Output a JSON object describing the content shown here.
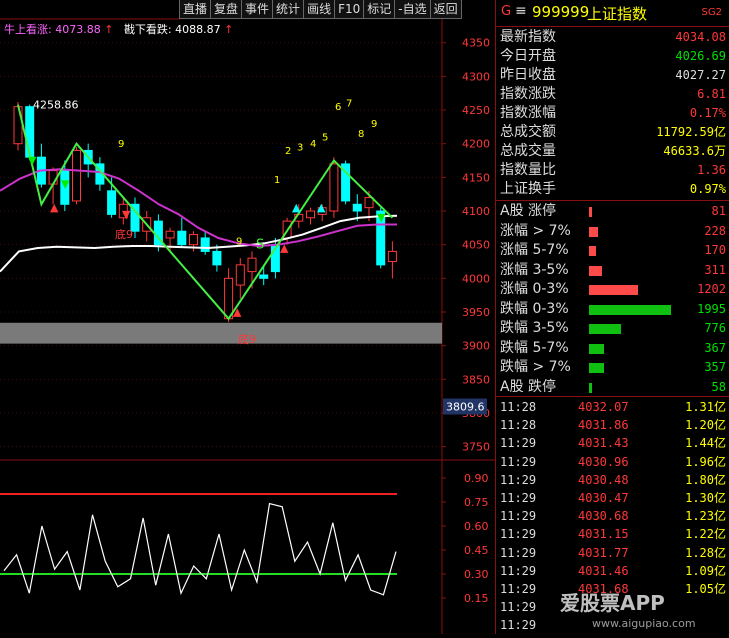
{
  "toolbar": [
    "直播",
    "复盘",
    "事件",
    "统计",
    "画线",
    "F10",
    "标记",
    "-自选",
    "返回"
  ],
  "legend": {
    "bull_label": "牛上看涨:",
    "bull_value": "4073.88",
    "bull_arrow": "↑",
    "bear_label": "戡下看跌:",
    "bear_value": "4088.87",
    "bear_arrow": "↑"
  },
  "chart_data": {
    "type": "candlestick",
    "ylim_main": [
      3700,
      4380
    ],
    "y_ticks_main": [
      "4350",
      "4300",
      "4250",
      "4200",
      "4150",
      "4100",
      "4050",
      "4000",
      "3950",
      "3900",
      "3850",
      "3800",
      "3750"
    ],
    "ylim_osc": [
      0,
      1.0
    ],
    "y_ticks_osc": [
      "0.90",
      "0.75",
      "0.60",
      "0.45",
      "0.30",
      "0.15"
    ],
    "price_tag": "3809.6",
    "annotations": {
      "high_label": "4258.86",
      "low_label": "底9",
      "mid_label": "底9",
      "seq_top": [
        "1",
        "2",
        "3",
        "4",
        "5",
        "6",
        "7",
        "8",
        "9"
      ],
      "seq_nine": "9",
      "s_marker": "S"
    },
    "candles": [
      {
        "o": 4200,
        "h": 4262,
        "l": 4190,
        "c": 4255
      },
      {
        "o": 4255,
        "h": 4258,
        "l": 4175,
        "c": 4180
      },
      {
        "o": 4180,
        "h": 4200,
        "l": 4135,
        "c": 4140
      },
      {
        "o": 4140,
        "h": 4165,
        "l": 4110,
        "c": 4160
      },
      {
        "o": 4160,
        "h": 4175,
        "l": 4100,
        "c": 4110
      },
      {
        "o": 4115,
        "h": 4195,
        "l": 4110,
        "c": 4190
      },
      {
        "o": 4190,
        "h": 4200,
        "l": 4150,
        "c": 4170
      },
      {
        "o": 4170,
        "h": 4180,
        "l": 4130,
        "c": 4140
      },
      {
        "o": 4130,
        "h": 4150,
        "l": 4090,
        "c": 4095
      },
      {
        "o": 4090,
        "h": 4120,
        "l": 4080,
        "c": 4110
      },
      {
        "o": 4110,
        "h": 4120,
        "l": 4060,
        "c": 4070
      },
      {
        "o": 4070,
        "h": 4100,
        "l": 4055,
        "c": 4090
      },
      {
        "o": 4085,
        "h": 4095,
        "l": 4040,
        "c": 4050
      },
      {
        "o": 4060,
        "h": 4075,
        "l": 4040,
        "c": 4070
      },
      {
        "o": 4070,
        "h": 4090,
        "l": 4045,
        "c": 4050
      },
      {
        "o": 4050,
        "h": 4070,
        "l": 4040,
        "c": 4065
      },
      {
        "o": 4060,
        "h": 4070,
        "l": 4035,
        "c": 4040
      },
      {
        "o": 4040,
        "h": 4050,
        "l": 4010,
        "c": 4020
      },
      {
        "o": 3940,
        "h": 4015,
        "l": 3935,
        "c": 4000
      },
      {
        "o": 3990,
        "h": 4030,
        "l": 3970,
        "c": 4020
      },
      {
        "o": 4010,
        "h": 4040,
        "l": 3985,
        "c": 4030
      },
      {
        "o": 4005,
        "h": 4020,
        "l": 3990,
        "c": 4000
      },
      {
        "o": 4050,
        "h": 4060,
        "l": 4000,
        "c": 4010
      },
      {
        "o": 4060,
        "h": 4090,
        "l": 4050,
        "c": 4085
      },
      {
        "o": 4085,
        "h": 4110,
        "l": 4075,
        "c": 4095
      },
      {
        "o": 4090,
        "h": 4105,
        "l": 4080,
        "c": 4100
      },
      {
        "o": 4095,
        "h": 4110,
        "l": 4085,
        "c": 4105
      },
      {
        "o": 4100,
        "h": 4180,
        "l": 4090,
        "c": 4170
      },
      {
        "o": 4170,
        "h": 4175,
        "l": 4110,
        "c": 4115
      },
      {
        "o": 4110,
        "h": 4125,
        "l": 4085,
        "c": 4100
      },
      {
        "o": 4105,
        "h": 4130,
        "l": 4085,
        "c": 4120
      },
      {
        "o": 4100,
        "h": 4105,
        "l": 4015,
        "c": 4020
      },
      {
        "o": 4025,
        "h": 4055,
        "l": 4000,
        "c": 4040
      }
    ],
    "ma_white": [
      4010,
      4040,
      4045,
      4047,
      4046,
      4045,
      4047,
      4048,
      4048,
      4047,
      4046,
      4045,
      4047,
      4049,
      4052,
      4058,
      4065,
      4075,
      4085,
      4090,
      4092,
      4093
    ],
    "ma_magenta": [
      4130,
      4148,
      4160,
      4162,
      4160,
      4158,
      4148,
      4130,
      4110,
      4095,
      4075,
      4060,
      4052,
      4048,
      4050,
      4055,
      4062,
      4070,
      4078,
      4080,
      4080
    ],
    "zigzag": [
      4258,
      4110,
      4200,
      3940,
      4175,
      4090
    ],
    "osc_line": [
      0.32,
      0.42,
      0.18,
      0.6,
      0.33,
      0.44,
      0.2,
      0.67,
      0.38,
      0.22,
      0.27,
      0.65,
      0.23,
      0.55,
      0.18,
      0.35,
      0.27,
      0.55,
      0.2,
      0.45,
      0.25,
      0.74,
      0.72,
      0.38,
      0.5,
      0.3,
      0.62,
      0.26,
      0.42,
      0.2,
      0.17,
      0.44
    ],
    "osc_red_level": 0.8,
    "osc_green_level": 0.3
  },
  "sidebar": {
    "header": {
      "g": "G",
      "menu": "≡",
      "code": "999999",
      "name": "上证指数",
      "badge": "SG2"
    },
    "stats": [
      {
        "label": "最新指数",
        "value": "4034.08",
        "color": "#ff3838"
      },
      {
        "label": "今日开盘",
        "value": "4026.69",
        "color": "#00e000"
      },
      {
        "label": "昨日收盘",
        "value": "4027.27",
        "color": "#dddddd"
      },
      {
        "label": "指数涨跌",
        "value": "6.81",
        "color": "#ff3838"
      },
      {
        "label": "指数涨幅",
        "value": "0.17%",
        "color": "#ff3838"
      },
      {
        "label": "总成交额",
        "value": "11792.59亿",
        "color": "#ffff00"
      },
      {
        "label": "总成交量",
        "value": "46633.6万",
        "color": "#ffff00"
      },
      {
        "label": "指数量比",
        "value": "1.36",
        "color": "#ff3838"
      },
      {
        "label": "上证换手",
        "value": "0.97%",
        "color": "#ffff00"
      }
    ],
    "breadth": [
      {
        "label": "A股 涨停",
        "value": "81",
        "color": "#ff3838",
        "bar_color": "#ff4a4a",
        "count": 81
      },
      {
        "label": "涨幅 > 7%",
        "value": "228",
        "color": "#ff3838",
        "bar_color": "#ff4a4a",
        "count": 228
      },
      {
        "label": "涨幅 5-7%",
        "value": "170",
        "color": "#ff3838",
        "bar_color": "#ff4a4a",
        "count": 170
      },
      {
        "label": "涨幅 3-5%",
        "value": "311",
        "color": "#ff3838",
        "bar_color": "#ff4a4a",
        "count": 311
      },
      {
        "label": "涨幅 0-3%",
        "value": "1202",
        "color": "#ff3838",
        "bar_color": "#ff4a4a",
        "count": 1202
      },
      {
        "label": "跌幅 0-3%",
        "value": "1995",
        "color": "#00e000",
        "bar_color": "#10c010",
        "count": 1995
      },
      {
        "label": "跌幅 3-5%",
        "value": "776",
        "color": "#00e000",
        "bar_color": "#10c010",
        "count": 776
      },
      {
        "label": "跌幅 5-7%",
        "value": "367",
        "color": "#00e000",
        "bar_color": "#10c010",
        "count": 367
      },
      {
        "label": "跌幅 > 7%",
        "value": "357",
        "color": "#00e000",
        "bar_color": "#10c010",
        "count": 357
      },
      {
        "label": "A股 跌停",
        "value": "58",
        "color": "#00e000",
        "bar_color": "#10c010",
        "count": 58
      }
    ],
    "ticks": [
      {
        "time": "11:28",
        "price": "4032.07",
        "vol": "1.31亿"
      },
      {
        "time": "11:28",
        "price": "4031.86",
        "vol": "1.20亿"
      },
      {
        "time": "11:29",
        "price": "4031.43",
        "vol": "1.44亿"
      },
      {
        "time": "11:29",
        "price": "4030.96",
        "vol": "1.96亿"
      },
      {
        "time": "11:29",
        "price": "4030.48",
        "vol": "1.80亿"
      },
      {
        "time": "11:29",
        "price": "4030.47",
        "vol": "1.30亿"
      },
      {
        "time": "11:29",
        "price": "4030.68",
        "vol": "1.23亿"
      },
      {
        "time": "11:29",
        "price": "4031.15",
        "vol": "1.22亿"
      },
      {
        "time": "11:29",
        "price": "4031.77",
        "vol": "1.28亿"
      },
      {
        "time": "11:29",
        "price": "4031.46",
        "vol": "1.09亿"
      },
      {
        "time": "11:29",
        "price": "4031.68",
        "vol": "1.05亿"
      },
      {
        "time": "11:29",
        "price": "",
        "vol": ""
      },
      {
        "time": "11:29",
        "price": "",
        "vol": ""
      }
    ],
    "watermark": "爱股票APP",
    "watermark_sub": "www.aigupiao.com"
  }
}
